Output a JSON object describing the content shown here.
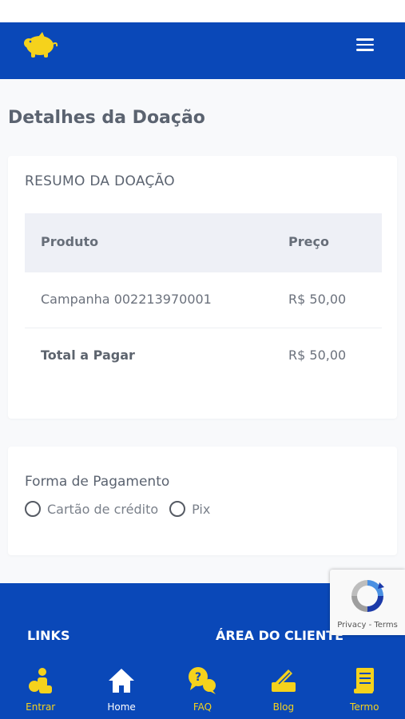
{
  "header": {
    "logo_icon": "piggy-bank-icon",
    "menu_icon": "hamburger-menu-icon"
  },
  "page": {
    "title": "Detalhes da Doação"
  },
  "summary": {
    "title": "RESUMO DA DOAÇÃO",
    "columns": {
      "produto": "Produto",
      "preco": "Preço"
    },
    "items": [
      {
        "produto": "Campanha 002213970001",
        "preco": "R$ 50,00"
      }
    ],
    "total": {
      "label": "Total a Pagar",
      "value": "R$ 50,00"
    }
  },
  "payment": {
    "title": "Forma de Pagamento",
    "options": [
      {
        "label": "Cartão de crédito",
        "selected": false
      },
      {
        "label": "Pix",
        "selected": false
      }
    ]
  },
  "footer": {
    "links_heading": "LINKS",
    "area_heading": "ÁREA DO CLIENTE"
  },
  "recaptcha": {
    "text": "Privacy - Terms",
    "icon": "recaptcha-icon"
  },
  "bottom_nav": [
    {
      "label": "Entrar",
      "icon": "login-icon",
      "active": false
    },
    {
      "label": "Home",
      "icon": "home-icon",
      "active": true
    },
    {
      "label": "FAQ",
      "icon": "faq-icon",
      "active": false
    },
    {
      "label": "Blog",
      "icon": "blog-icon",
      "active": false
    },
    {
      "label": "Termo",
      "icon": "document-icon",
      "active": false
    }
  ],
  "colors": {
    "brand_blue": "#0a48b8",
    "accent_yellow": "#f5d21c",
    "white": "#ffffff"
  }
}
